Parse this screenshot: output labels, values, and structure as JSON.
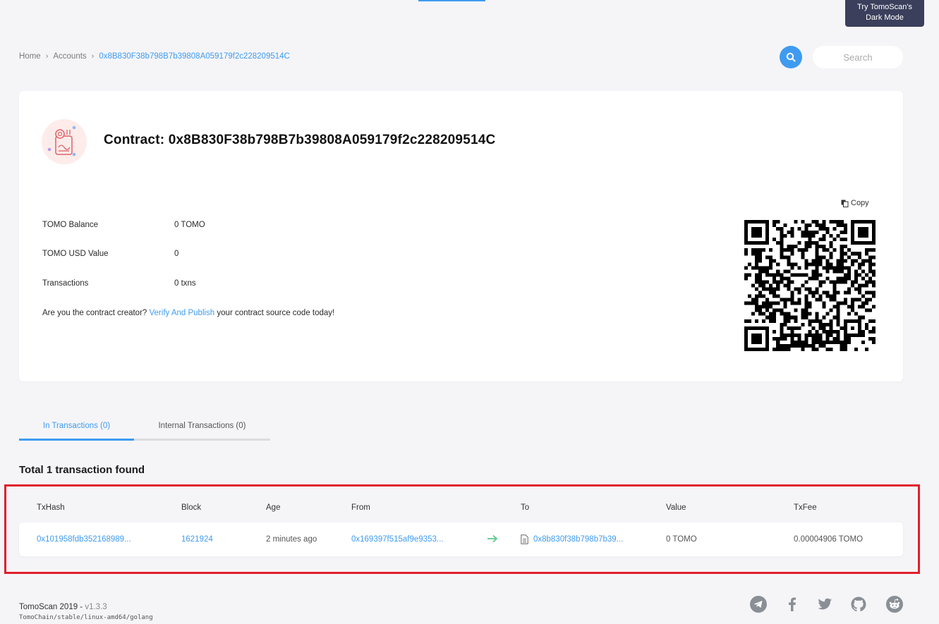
{
  "top": {
    "dark_mode_label": "Try TomoScan's Dark Mode"
  },
  "breadcrumb": {
    "home": "Home",
    "sep": "›",
    "accounts": "Accounts",
    "current": "0x8B830F38b798B7b39808A059179f2c228209514C"
  },
  "search": {
    "placeholder": "Search"
  },
  "contract": {
    "title": "Contract: 0x8B830F38b798B7b39808A059179f2c228209514C",
    "rows": [
      {
        "label": "TOMO Balance",
        "value": "0 TOMO"
      },
      {
        "label": "TOMO USD Value",
        "value": "0"
      },
      {
        "label": "Transactions",
        "value": "0 txns"
      }
    ],
    "verify_prefix": "Are you the contract creator? ",
    "verify_link": "Verify And Publish",
    "verify_suffix": " your contract source code today!",
    "copy_label": "Copy"
  },
  "tabs": [
    {
      "label": "In Transactions (0)"
    },
    {
      "label": "Internal Transactions (0)"
    }
  ],
  "total_label": "Total 1 transaction found",
  "table": {
    "headers": [
      "TxHash",
      "Block",
      "Age",
      "From",
      "To",
      "Value",
      "TxFee"
    ],
    "rows": [
      {
        "txhash": "0x101958fdb352168989...",
        "block": "1621924",
        "age": "2 minutes ago",
        "from": "0x169397f515af9e9353...",
        "to": "0x8b830f38b798b7b39...",
        "value": "0 TOMO",
        "txfee": "0.00004906 TOMO"
      }
    ]
  },
  "footer": {
    "title": "TomoScan 2019 - ",
    "version": "v1.3.3",
    "subtitle": "TomoChain/stable/linux-amd64/golang",
    "social_icons": [
      "telegram-icon",
      "facebook-icon",
      "twitter-icon",
      "github-icon",
      "reddit-icon"
    ]
  },
  "colors": {
    "accent": "#3f9bf0",
    "highlight_border": "#e0202c",
    "dark_button": "#3b3f5c",
    "arrow_green": "#5cc98a"
  }
}
